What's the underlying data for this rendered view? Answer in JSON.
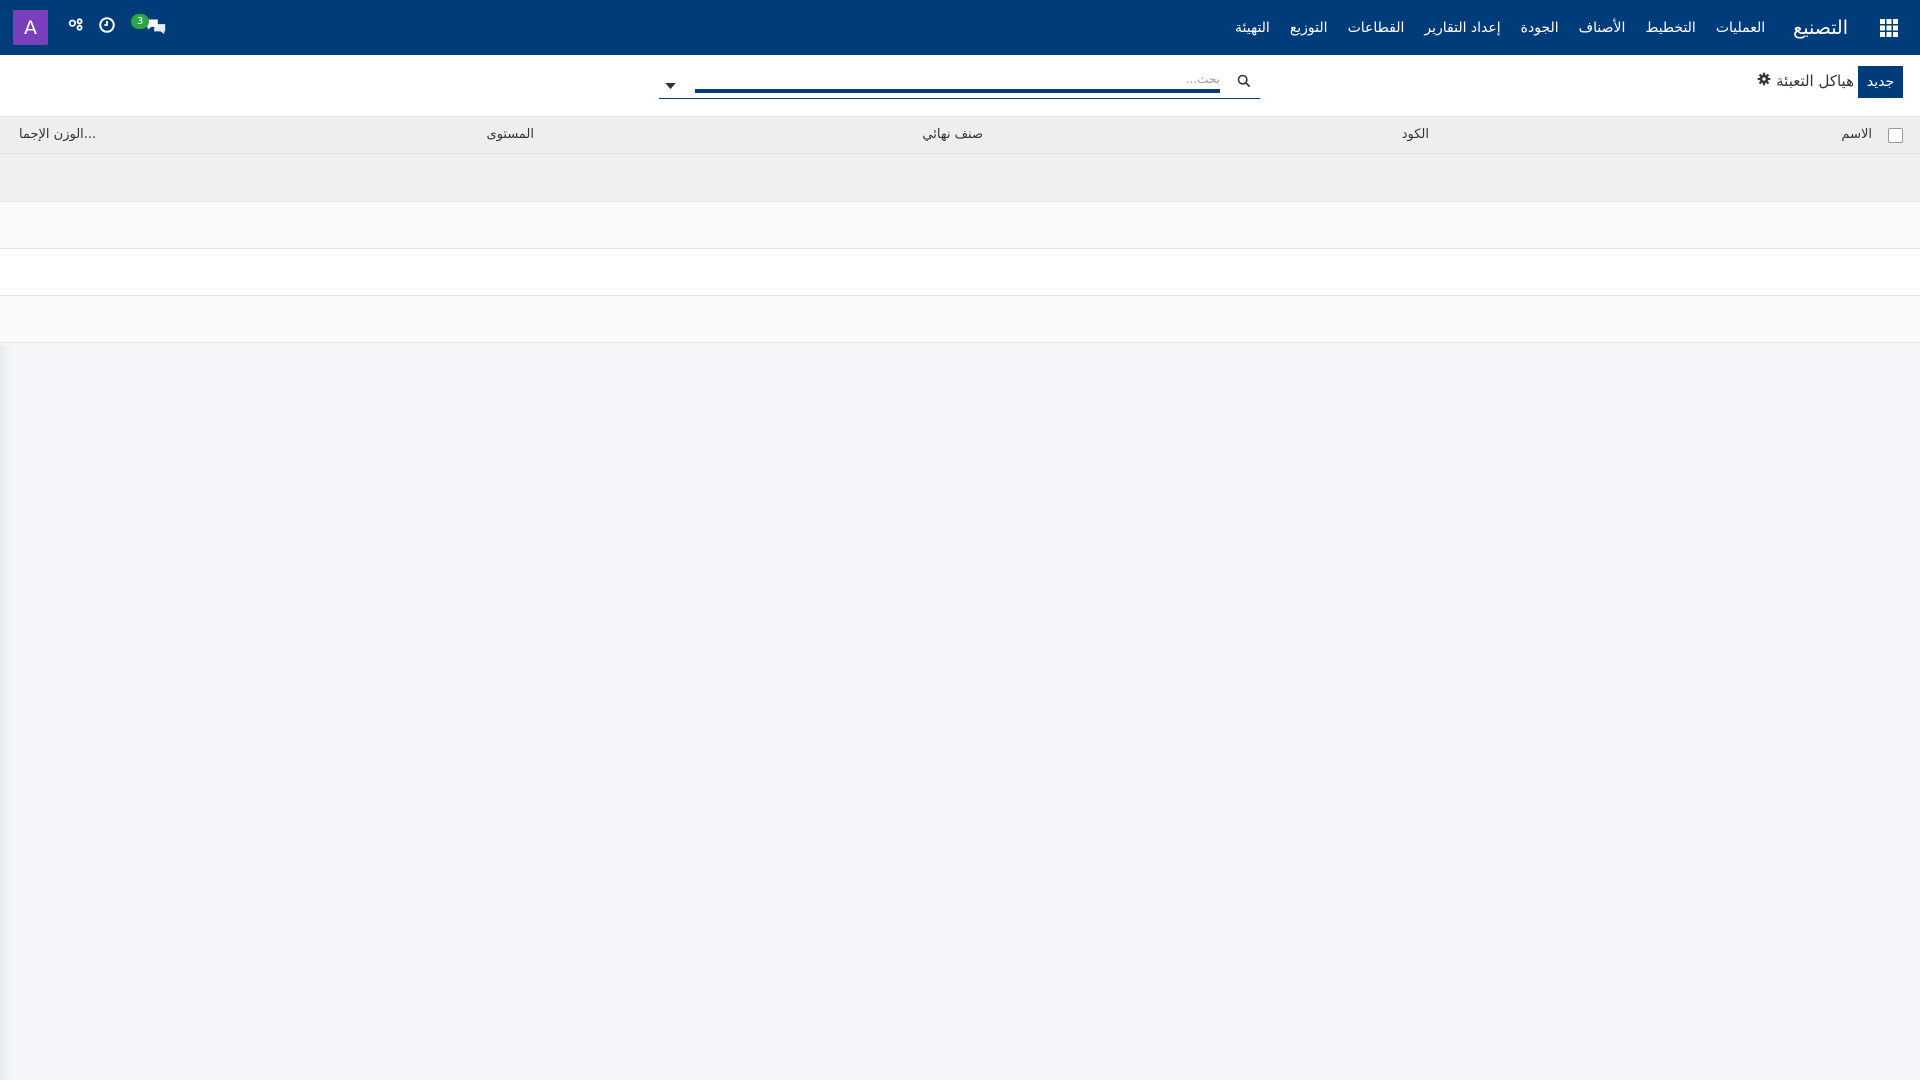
{
  "theme": {
    "nav_bg": "#003b7a",
    "avatar_bg": "#7b3fbe",
    "badge_bg": "#28a745"
  },
  "navbar": {
    "app_title": "التصنيع",
    "menu": [
      "العمليات",
      "التخطيط",
      "الأصناف",
      "الجودة",
      "إعداد التقارير",
      "القطاعات",
      "التوزيع",
      "التهيئة"
    ],
    "apps_icon": "grid-icon",
    "chat_badge": "3",
    "user_avatar": "A",
    "icons": [
      "chat-icon",
      "clock-icon",
      "debug-icon"
    ]
  },
  "control_panel": {
    "new_button": "جديد",
    "title": "هياكل التعبئة",
    "search_placeholder": "بحث..."
  },
  "table": {
    "columns": [
      "الاسم",
      "الكود",
      "صنف نهائي",
      "المستوى",
      "الوزن الإجما..."
    ],
    "rows": []
  }
}
